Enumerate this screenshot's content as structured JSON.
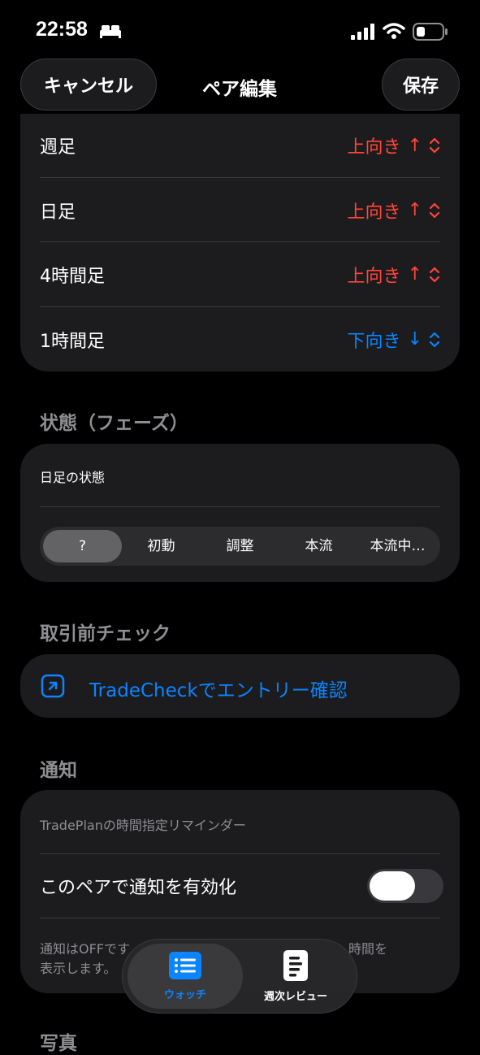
{
  "status_bar": {
    "time": "22:58",
    "icons": [
      "bed-icon",
      "cellular-icon",
      "wifi-icon",
      "battery-icon"
    ]
  },
  "nav": {
    "cancel_label": "キャンセル",
    "title": "ペア編集",
    "save_label": "保存"
  },
  "timeframes": [
    {
      "label": "週足",
      "value": "上向き",
      "arrow": "↑",
      "direction": "up"
    },
    {
      "label": "日足",
      "value": "上向き",
      "arrow": "↑",
      "direction": "up"
    },
    {
      "label": "4時間足",
      "value": "上向き",
      "arrow": "↑",
      "direction": "up"
    },
    {
      "label": "1時間足",
      "value": "下向き",
      "arrow": "↓",
      "direction": "down"
    }
  ],
  "phase": {
    "section_title": "状態（フェーズ）",
    "label": "日足の状態",
    "options": [
      "?",
      "初動",
      "調整",
      "本流",
      "本流中…"
    ],
    "selected_index": 0
  },
  "pretrade": {
    "section_title": "取引前チェック",
    "link_label": "TradeCheckでエントリー確認"
  },
  "notification": {
    "section_title": "通知",
    "subtitle": "TradePlanの時間指定リマインダー",
    "toggle_label": "このペアで通知を有効化",
    "enabled": false,
    "footer_line1_left": "通知はOFFです",
    "footer_line1_right": "時間を",
    "footer_line2": "表示します。"
  },
  "next_section_title": "写真",
  "tabbar": {
    "watch_label": "ウォッチ",
    "review_label": "週次レビュー",
    "active": "watch"
  },
  "colors": {
    "up": "#ff453a",
    "down": "#0a84ff",
    "accent": "#0a84ff",
    "card": "#1c1c1e"
  }
}
